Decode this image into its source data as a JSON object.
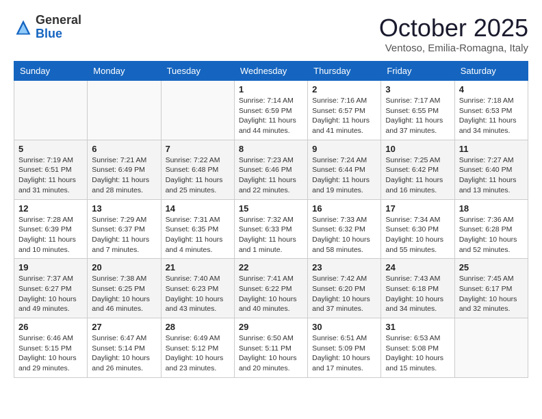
{
  "header": {
    "logo_general": "General",
    "logo_blue": "Blue",
    "month_title": "October 2025",
    "subtitle": "Ventoso, Emilia-Romagna, Italy"
  },
  "weekdays": [
    "Sunday",
    "Monday",
    "Tuesday",
    "Wednesday",
    "Thursday",
    "Friday",
    "Saturday"
  ],
  "weeks": [
    [
      {
        "day": "",
        "info": ""
      },
      {
        "day": "",
        "info": ""
      },
      {
        "day": "",
        "info": ""
      },
      {
        "day": "1",
        "info": "Sunrise: 7:14 AM\nSunset: 6:59 PM\nDaylight: 11 hours and 44 minutes."
      },
      {
        "day": "2",
        "info": "Sunrise: 7:16 AM\nSunset: 6:57 PM\nDaylight: 11 hours and 41 minutes."
      },
      {
        "day": "3",
        "info": "Sunrise: 7:17 AM\nSunset: 6:55 PM\nDaylight: 11 hours and 37 minutes."
      },
      {
        "day": "4",
        "info": "Sunrise: 7:18 AM\nSunset: 6:53 PM\nDaylight: 11 hours and 34 minutes."
      }
    ],
    [
      {
        "day": "5",
        "info": "Sunrise: 7:19 AM\nSunset: 6:51 PM\nDaylight: 11 hours and 31 minutes."
      },
      {
        "day": "6",
        "info": "Sunrise: 7:21 AM\nSunset: 6:49 PM\nDaylight: 11 hours and 28 minutes."
      },
      {
        "day": "7",
        "info": "Sunrise: 7:22 AM\nSunset: 6:48 PM\nDaylight: 11 hours and 25 minutes."
      },
      {
        "day": "8",
        "info": "Sunrise: 7:23 AM\nSunset: 6:46 PM\nDaylight: 11 hours and 22 minutes."
      },
      {
        "day": "9",
        "info": "Sunrise: 7:24 AM\nSunset: 6:44 PM\nDaylight: 11 hours and 19 minutes."
      },
      {
        "day": "10",
        "info": "Sunrise: 7:25 AM\nSunset: 6:42 PM\nDaylight: 11 hours and 16 minutes."
      },
      {
        "day": "11",
        "info": "Sunrise: 7:27 AM\nSunset: 6:40 PM\nDaylight: 11 hours and 13 minutes."
      }
    ],
    [
      {
        "day": "12",
        "info": "Sunrise: 7:28 AM\nSunset: 6:39 PM\nDaylight: 11 hours and 10 minutes."
      },
      {
        "day": "13",
        "info": "Sunrise: 7:29 AM\nSunset: 6:37 PM\nDaylight: 11 hours and 7 minutes."
      },
      {
        "day": "14",
        "info": "Sunrise: 7:31 AM\nSunset: 6:35 PM\nDaylight: 11 hours and 4 minutes."
      },
      {
        "day": "15",
        "info": "Sunrise: 7:32 AM\nSunset: 6:33 PM\nDaylight: 11 hours and 1 minute."
      },
      {
        "day": "16",
        "info": "Sunrise: 7:33 AM\nSunset: 6:32 PM\nDaylight: 10 hours and 58 minutes."
      },
      {
        "day": "17",
        "info": "Sunrise: 7:34 AM\nSunset: 6:30 PM\nDaylight: 10 hours and 55 minutes."
      },
      {
        "day": "18",
        "info": "Sunrise: 7:36 AM\nSunset: 6:28 PM\nDaylight: 10 hours and 52 minutes."
      }
    ],
    [
      {
        "day": "19",
        "info": "Sunrise: 7:37 AM\nSunset: 6:27 PM\nDaylight: 10 hours and 49 minutes."
      },
      {
        "day": "20",
        "info": "Sunrise: 7:38 AM\nSunset: 6:25 PM\nDaylight: 10 hours and 46 minutes."
      },
      {
        "day": "21",
        "info": "Sunrise: 7:40 AM\nSunset: 6:23 PM\nDaylight: 10 hours and 43 minutes."
      },
      {
        "day": "22",
        "info": "Sunrise: 7:41 AM\nSunset: 6:22 PM\nDaylight: 10 hours and 40 minutes."
      },
      {
        "day": "23",
        "info": "Sunrise: 7:42 AM\nSunset: 6:20 PM\nDaylight: 10 hours and 37 minutes."
      },
      {
        "day": "24",
        "info": "Sunrise: 7:43 AM\nSunset: 6:18 PM\nDaylight: 10 hours and 34 minutes."
      },
      {
        "day": "25",
        "info": "Sunrise: 7:45 AM\nSunset: 6:17 PM\nDaylight: 10 hours and 32 minutes."
      }
    ],
    [
      {
        "day": "26",
        "info": "Sunrise: 6:46 AM\nSunset: 5:15 PM\nDaylight: 10 hours and 29 minutes."
      },
      {
        "day": "27",
        "info": "Sunrise: 6:47 AM\nSunset: 5:14 PM\nDaylight: 10 hours and 26 minutes."
      },
      {
        "day": "28",
        "info": "Sunrise: 6:49 AM\nSunset: 5:12 PM\nDaylight: 10 hours and 23 minutes."
      },
      {
        "day": "29",
        "info": "Sunrise: 6:50 AM\nSunset: 5:11 PM\nDaylight: 10 hours and 20 minutes."
      },
      {
        "day": "30",
        "info": "Sunrise: 6:51 AM\nSunset: 5:09 PM\nDaylight: 10 hours and 17 minutes."
      },
      {
        "day": "31",
        "info": "Sunrise: 6:53 AM\nSunset: 5:08 PM\nDaylight: 10 hours and 15 minutes."
      },
      {
        "day": "",
        "info": ""
      }
    ]
  ]
}
